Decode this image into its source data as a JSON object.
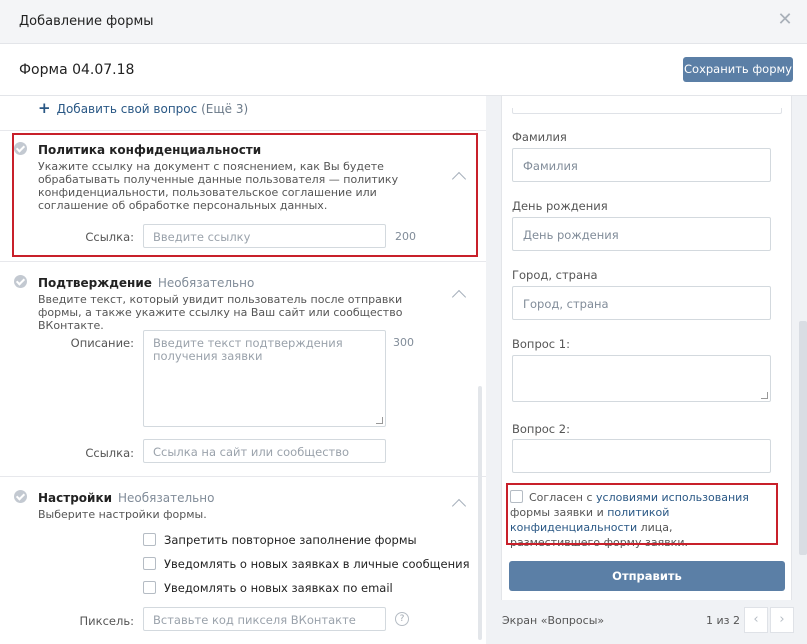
{
  "modal": {
    "title": "Добавление формы",
    "close_icon": "close-icon"
  },
  "header": {
    "form_name": "Форма 04.07.18",
    "save_label": "Сохранить форму"
  },
  "add_question": {
    "label": "Добавить свой вопрос",
    "remaining": "(Ещё 3)"
  },
  "privacy": {
    "title": "Политика конфиденциальности",
    "description": "Укажите ссылку на документ с пояснением, как Вы будете обрабатывать полученные данные пользователя — политику конфиденциальности, пользовательское соглашение или соглашение об обработке персональных данных.",
    "link_label": "Ссылка:",
    "link_placeholder": "Введите ссылку",
    "link_limit": "200"
  },
  "confirmation": {
    "title": "Подтверждение",
    "optional": "Необязательно",
    "description": "Введите текст, который увидит пользователь после отправки формы, а также укажите ссылку на Ваш сайт или сообщество ВКонтакте.",
    "desc_label": "Описание:",
    "desc_placeholder": "Введите текст подтверждения получения заявки",
    "desc_limit": "300",
    "link_label": "Ссылка:",
    "link_placeholder": "Ссылка на сайт или сообщество"
  },
  "settings": {
    "title": "Настройки",
    "optional": "Необязательно",
    "description": "Выберите настройки формы.",
    "options": [
      {
        "label": "Запретить повторное заполнение формы",
        "checked": false
      },
      {
        "label": "Уведомлять о новых заявках в личные сообщения",
        "checked": false
      },
      {
        "label": "Уведомлять о новых заявках по email",
        "checked": false
      }
    ],
    "pixel_label": "Пиксель:",
    "pixel_placeholder": "Вставьте код пикселя ВКонтакте",
    "help_symbol": "?"
  },
  "preview": {
    "fields": [
      {
        "label": "Фамилия",
        "placeholder": "Фамилия"
      },
      {
        "label": "День рождения",
        "placeholder": "День рождения"
      },
      {
        "label": "Город, страна",
        "placeholder": "Город, страна"
      },
      {
        "label": "Вопрос 1:",
        "placeholder": ""
      },
      {
        "label": "Вопрос 2:",
        "placeholder": ""
      }
    ],
    "consent": {
      "prefix": "Согласен с ",
      "terms_link": "условиями использования",
      "middle": " формы заявки и ",
      "policy_link": "политикой конфиденциальности",
      "suffix": " лица, разместившего форму заявки."
    },
    "send_label": "Отправить",
    "screen_label": "Экран «Вопросы»",
    "page_count": "1 из 2",
    "prev_symbol": "‹",
    "next_symbol": "›"
  },
  "colors": {
    "accent": "#5b7fa6",
    "link": "#2a5885",
    "highlight": "#c8202a"
  }
}
